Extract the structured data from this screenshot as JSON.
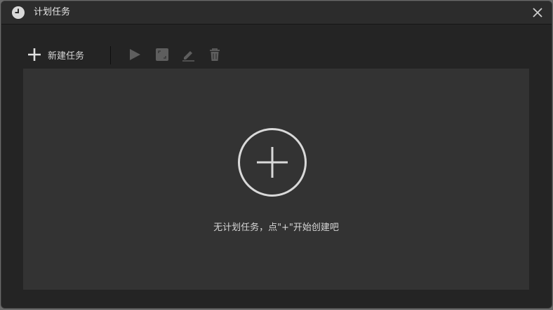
{
  "window": {
    "title": "计划任务",
    "icons": {
      "app": "clock-icon",
      "close": "close-icon"
    }
  },
  "toolbar": {
    "new_task_label": "新建任务",
    "icons": [
      "plus-icon",
      "play-icon",
      "stop-icon",
      "edit-icon",
      "delete-icon"
    ]
  },
  "empty_state": {
    "message": "无计划任务，点\"+\"开始创建吧",
    "icon": "add-circle-icon"
  },
  "colors": {
    "window_bg": "#242424",
    "content_bg": "#333333",
    "text": "#d6d6d6",
    "disabled_icon": "#5e5e5e"
  }
}
